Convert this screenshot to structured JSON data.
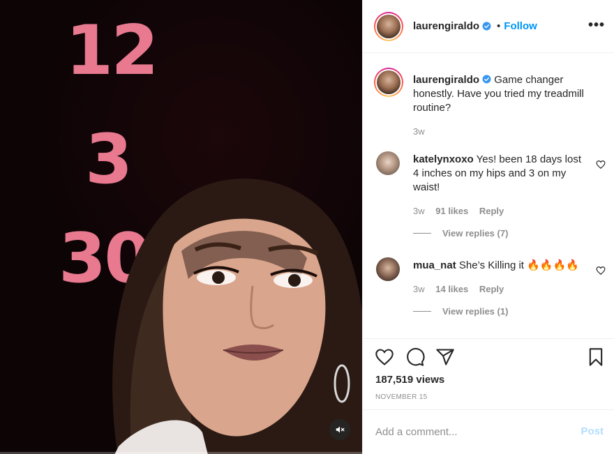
{
  "media": {
    "overlay_numbers": [
      "12",
      "3",
      "30"
    ],
    "muted": true
  },
  "header": {
    "username": "laurengiraldo",
    "verified": true,
    "separator": "•",
    "follow_label": "Follow",
    "more_label": "•••"
  },
  "caption": {
    "username": "laurengiraldo",
    "text": "Game changer honestly. Have you tried my treadmill routine?",
    "time": "3w"
  },
  "comments": [
    {
      "username": "katelynxoxo",
      "text": "Yes! been 18 days lost 4 inches on my hips and 3 on my waist!",
      "time": "3w",
      "likes": "91 likes",
      "reply_label": "Reply",
      "view_replies": "View replies (7)"
    },
    {
      "username": "mua_nat",
      "text": "She’s Killing it 🔥🔥🔥🔥",
      "time": "3w",
      "likes": "14 likes",
      "reply_label": "Reply",
      "view_replies": "View replies (1)"
    }
  ],
  "actions": {
    "icons": [
      "heart-icon",
      "comment-icon",
      "share-icon",
      "bookmark-icon"
    ],
    "views": "187,519 views",
    "date": "NOVEMBER 15"
  },
  "add_comment": {
    "placeholder": "Add a comment...",
    "post_label": "Post"
  },
  "colors": {
    "accent": "#0095f6",
    "overlay_number": "#e8798f",
    "post_disabled": "#b2dffc",
    "muted_text": "#8e8e8e"
  }
}
